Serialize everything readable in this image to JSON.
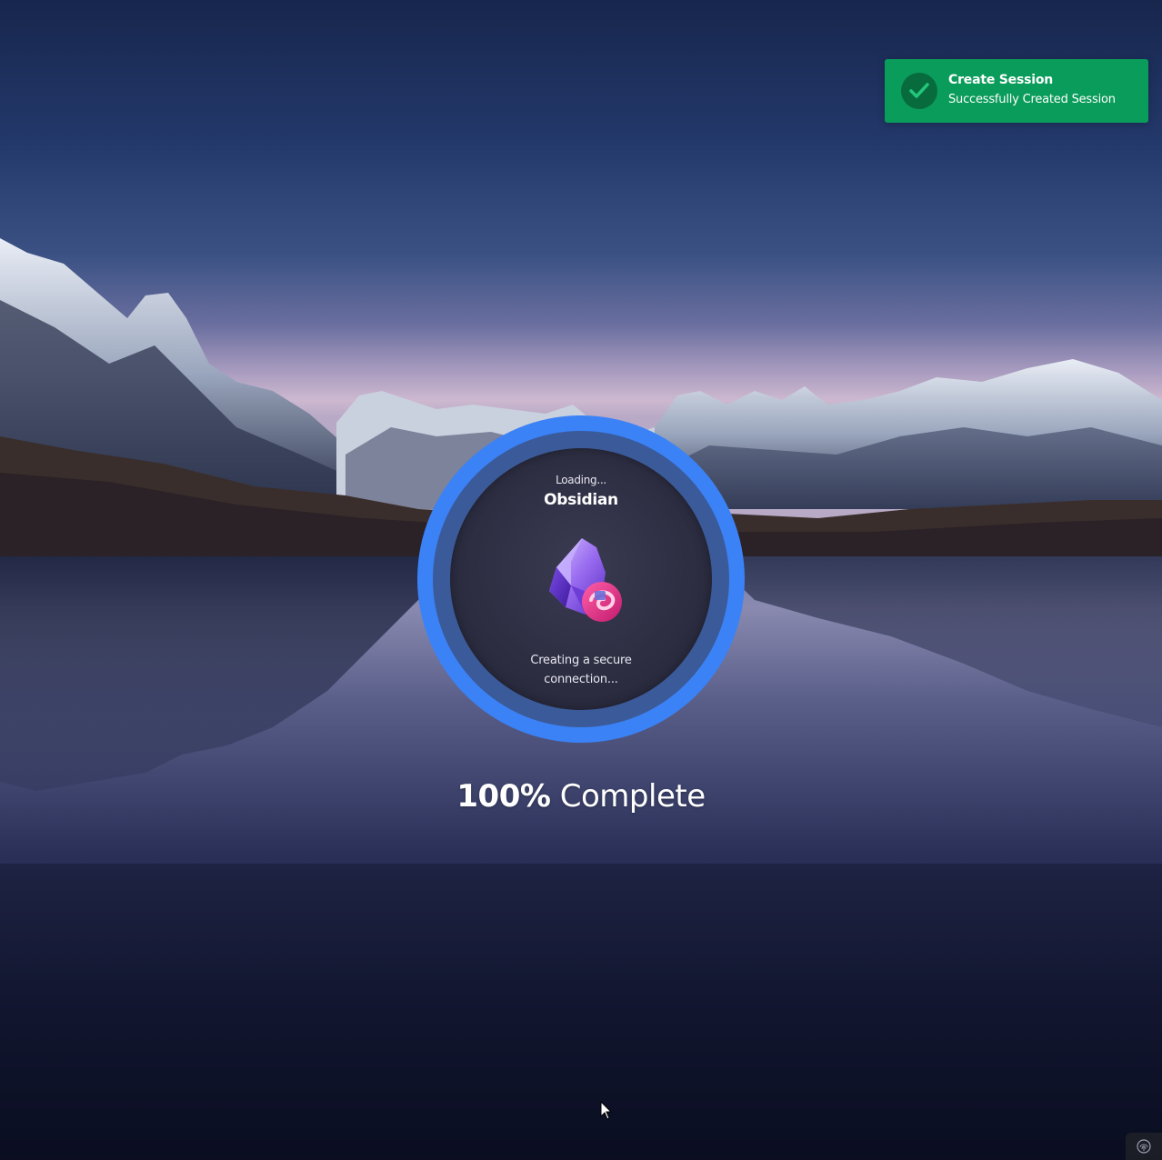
{
  "toast": {
    "title": "Create Session",
    "message": "Successfully Created Session",
    "icon": "check-circle-icon",
    "color": "#0a9c5a"
  },
  "loader": {
    "loading_label": "Loading...",
    "app_name": "Obsidian",
    "app_logo": "obsidian-logo",
    "status": "Creating a secure connection...",
    "ring_color": "#3b82f6"
  },
  "progress": {
    "percent": 100,
    "value_text": "100%",
    "label": "Complete"
  },
  "corner": {
    "icon": "fingerprint-icon"
  }
}
